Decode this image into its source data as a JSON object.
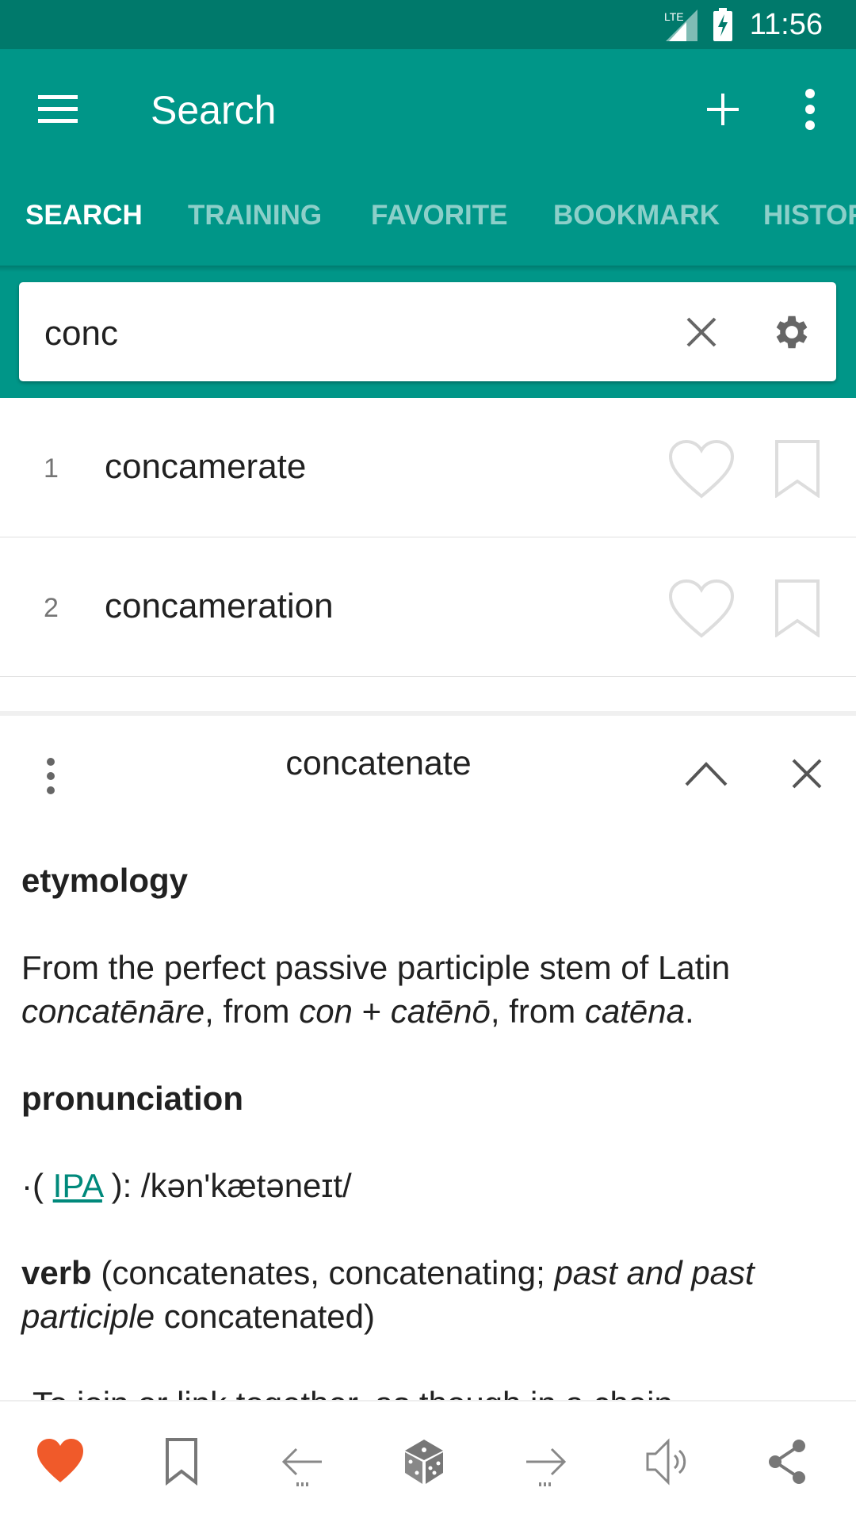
{
  "status": {
    "network": "LTE",
    "time": "11:56"
  },
  "appbar": {
    "title": "Search"
  },
  "tabs": [
    {
      "label": "SEARCH",
      "active": true
    },
    {
      "label": "TRAINING"
    },
    {
      "label": "FAVORITE"
    },
    {
      "label": "BOOKMARK"
    },
    {
      "label": "HISTORY"
    }
  ],
  "search": {
    "value": "conc"
  },
  "results": [
    {
      "num": "1",
      "word": "concamerate"
    },
    {
      "num": "2",
      "word": "concameration"
    }
  ],
  "detail": {
    "title": "concatenate",
    "etymology_heading": "etymology",
    "etymology": {
      "t1": "From the perfect passive participle stem of Latin ",
      "i1": "concatēnāre",
      "t2": ", from ",
      "i2": "con",
      "t3": " + ",
      "i3": "catēnō",
      "t4": ", from ",
      "i4": "catēna",
      "t5": "."
    },
    "pronunciation_heading": "pronunciation",
    "pron": {
      "pre": "·( ",
      "link": "IPA",
      "post": " ): /kən'kætəneɪt/"
    },
    "verb": {
      "pos": "verb",
      "t1": " (concatenates, concatenating; ",
      "i1": "past and past participle",
      "t2": " concatenated)"
    },
    "definition": "·To join or link together, as though in a chain."
  },
  "bottom_bar": [
    "heart-icon",
    "bookmark-icon",
    "arrow-left-icon",
    "dice-icon",
    "arrow-right-icon",
    "speaker-icon",
    "share-icon"
  ],
  "colors": {
    "primary": "#009688",
    "primary_dark": "#00796B",
    "favorite": "#F05A2A",
    "link": "#00897B"
  }
}
